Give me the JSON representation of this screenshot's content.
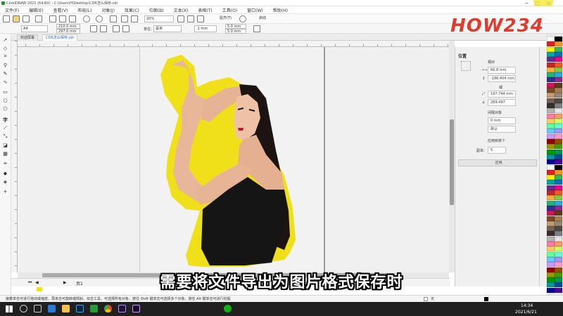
{
  "window": {
    "title": "CorelDRAW 2021 (64-Bit) - C:\\Users\\H\\Desktop\\CDR怎么保存.cdr",
    "controls": [
      "−",
      "□",
      "×"
    ]
  },
  "menu": [
    "文件(F)",
    "编辑(E)",
    "查看(V)",
    "布局(L)",
    "对象(J)",
    "效果(C)",
    "位图(B)",
    "文本(X)",
    "表格(T)",
    "工具(O)",
    "窗口(W)",
    "帮助(H)"
  ],
  "toolbar": {
    "zoom": "20%",
    "snap_label": "贴齐(T)",
    "launch_label": "启动",
    "page_size": "A4",
    "width": "210.0 mm",
    "height": "297.0 mm",
    "units_label": "单位:",
    "units": "毫米",
    "nudge": ".1 mm",
    "dup_x": "5.0 mm",
    "dup_y": "5.0 mm"
  },
  "tabs": [
    {
      "label": "欢迎屏幕"
    },
    {
      "label": "CDR怎么保存.cdr"
    }
  ],
  "docker": {
    "title": "位置",
    "relative_label": "相对",
    "x_value": "66.8 mm",
    "y_value": "-186.404 mm",
    "or_label": "或",
    "dist_value": "197.744 mm",
    "angle_value": "289.497",
    "spacing_label": "间隔对象",
    "spacing_value": "0 mm",
    "spacing_mode": "默认",
    "apply_each_label": "应用到单个",
    "copies_label": "副本:",
    "copies_value": "5",
    "apply_button": "应用"
  },
  "page_nav": {
    "label": "页1"
  },
  "status": {
    "hint": "接着单击可进行拖动或缩放，再单击可旋转或倾斜，双击工具，可选择所有对象，按住 Shift 键单击可选择多个对象，按住 Alt 键单击可进行挖掘",
    "fill_label": "无",
    "time": "14:34",
    "date": "2021/6/21"
  },
  "subtitle": "需要将文件导出为图片格式保存时",
  "watermark": "HOW234",
  "colors": {
    "accent": "#f5d30f",
    "outline": "#f0e01a",
    "taskbar": "#202020"
  }
}
